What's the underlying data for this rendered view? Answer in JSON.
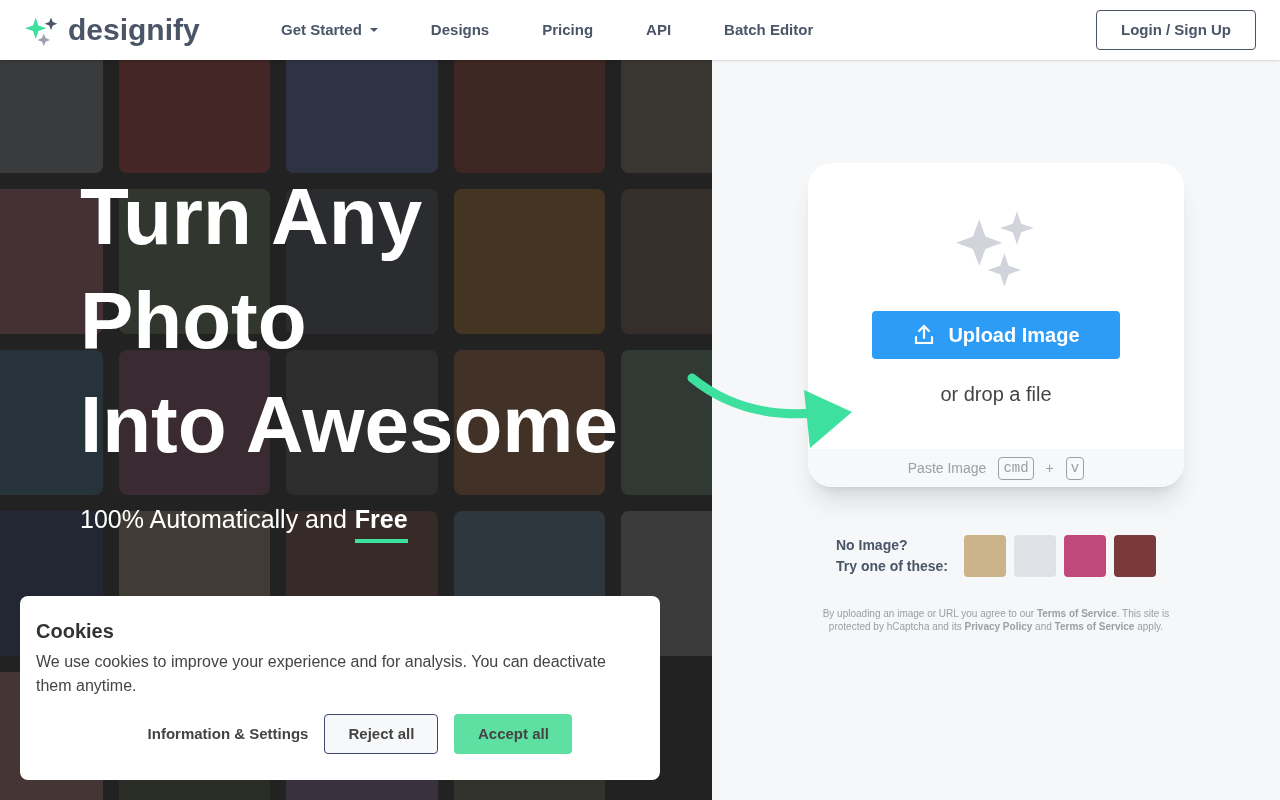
{
  "header": {
    "brand": "designify",
    "nav": [
      {
        "label": "Get Started",
        "dropdown": true
      },
      {
        "label": "Designs",
        "dropdown": false
      },
      {
        "label": "Pricing",
        "dropdown": false
      },
      {
        "label": "API",
        "dropdown": false
      },
      {
        "label": "Batch Editor",
        "dropdown": false
      }
    ],
    "login": "Login / Sign Up"
  },
  "hero": {
    "title_lines": [
      "Turn Any",
      "Photo",
      "Into Awesome"
    ],
    "subtitle": "100% Automatically and",
    "highlight": "Free"
  },
  "upload": {
    "button": "Upload Image",
    "drop_hint": "or drop a file",
    "paste_label": "Paste Image",
    "keys": [
      "cmd",
      "v"
    ],
    "plus": "+"
  },
  "samples": {
    "lines": [
      "No Image?",
      "Try one of these:"
    ]
  },
  "legal": "By uploading an image or URL you agree to our **Terms of Service**. This site is protected by hCaptcha and its **Privacy Policy** and **Terms of Service** apply.",
  "cookies": {
    "title": "Cookies",
    "text": "We use cookies to improve your experience and for analysis. You can deactivate them anytime.",
    "settings": "Information & Settings",
    "reject": "Reject all",
    "accept": "Accept all"
  }
}
